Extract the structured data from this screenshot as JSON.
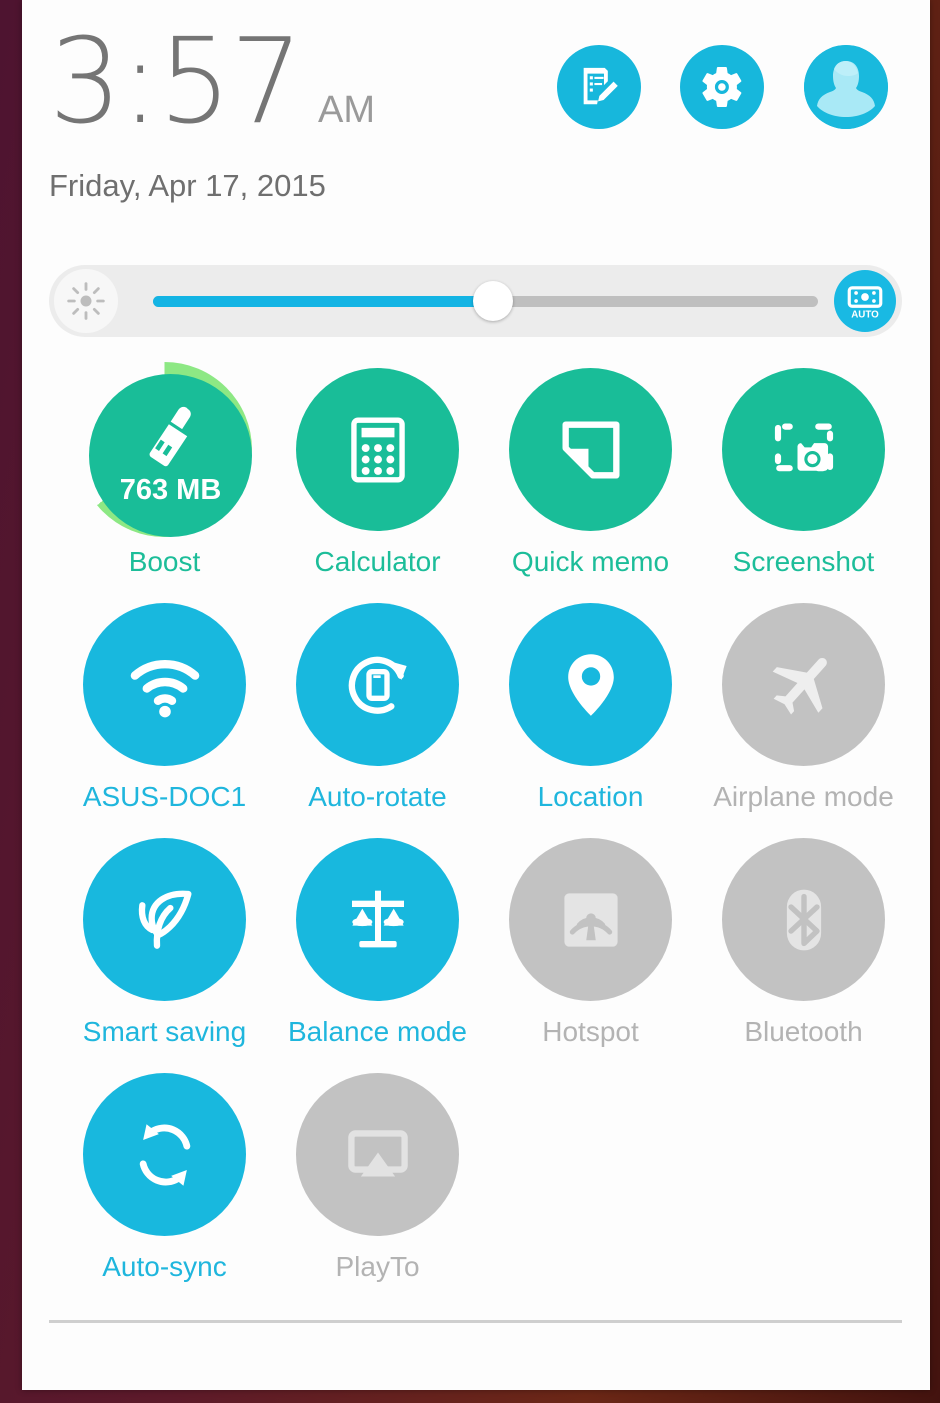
{
  "statusbar": {
    "clock_time": "3:57",
    "clock_ampm": "AM",
    "date": "Friday, Apr 17, 2015"
  },
  "header_actions": [
    {
      "name": "notes-button",
      "icon": "note-edit-icon",
      "label": "Notes"
    },
    {
      "name": "settings-button",
      "icon": "gear-icon",
      "label": "Settings"
    },
    {
      "name": "user-profile-button",
      "icon": "avatar-icon",
      "label": "User profile"
    }
  ],
  "brightness": {
    "left_icon": "brightness-sun-icon",
    "auto_label": "AUTO",
    "auto_icon": "auto-brightness-sensor-icon",
    "value_percent": 52
  },
  "tiles": [
    {
      "label": "Boost",
      "icon": "broom-icon",
      "state": "green",
      "value": "763 MB",
      "ring_percent": 64
    },
    {
      "label": "Calculator",
      "icon": "calculator-icon",
      "state": "green"
    },
    {
      "label": "Quick memo",
      "icon": "sticky-note-icon",
      "state": "green"
    },
    {
      "label": "Screenshot",
      "icon": "screenshot-camera-icon",
      "state": "green"
    },
    {
      "label": "ASUS-DOC1",
      "icon": "wifi-icon",
      "state": "cyan"
    },
    {
      "label": "Auto-rotate",
      "icon": "auto-rotate-icon",
      "state": "cyan"
    },
    {
      "label": "Location",
      "icon": "location-pin-icon",
      "state": "cyan"
    },
    {
      "label": "Airplane mode",
      "icon": "airplane-icon",
      "state": "off"
    },
    {
      "label": "Smart saving",
      "icon": "leaf-icon",
      "state": "cyan"
    },
    {
      "label": "Balance mode",
      "icon": "balance-scales-icon",
      "state": "cyan"
    },
    {
      "label": "Hotspot",
      "icon": "hotspot-tower-icon",
      "state": "off"
    },
    {
      "label": "Bluetooth",
      "icon": "bluetooth-icon",
      "state": "off"
    },
    {
      "label": "Auto-sync",
      "icon": "sync-arrows-icon",
      "state": "cyan"
    },
    {
      "label": "PlayTo",
      "icon": "cast-icon",
      "state": "off"
    }
  ],
  "colors": {
    "accent_cyan": "#18b8de",
    "accent_green": "#19bd98",
    "ring_green": "#8de884",
    "inactive_gray": "#c2c2c2",
    "slider_fill": "#14b4e4"
  }
}
